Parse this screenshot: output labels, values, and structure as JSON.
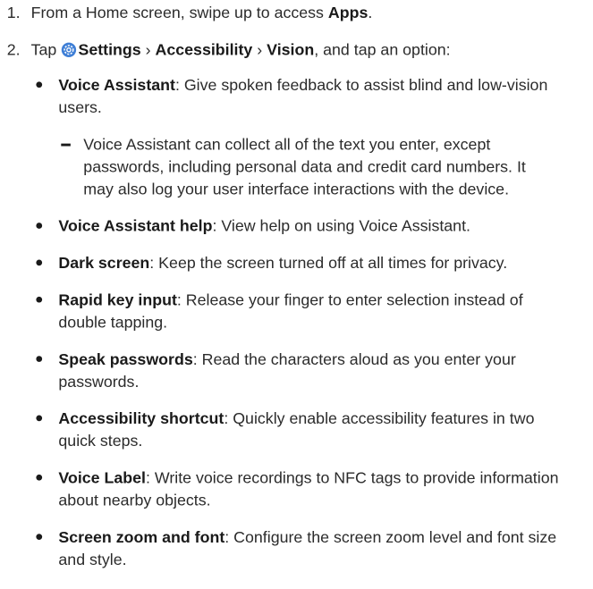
{
  "steps": [
    {
      "number": "1.",
      "text_before": "From a Home screen, swipe up to access ",
      "bold": "Apps",
      "text_after": "."
    },
    {
      "number": "2.",
      "tap": "Tap ",
      "settings": "Settings",
      "sep1": " › ",
      "accessibility": "Accessibility",
      "sep2": " › ",
      "vision": "Vision",
      "after": ", and tap an option:"
    }
  ],
  "bullets": [
    {
      "term": "Voice Assistant",
      "desc": ": Give spoken feedback to assist blind and low-vision users."
    },
    {
      "term": "Voice Assistant help",
      "desc": ": View help on using Voice Assistant."
    },
    {
      "term": "Dark screen",
      "desc": ": Keep the screen turned off at all times for privacy."
    },
    {
      "term": "Rapid key input",
      "desc": ": Release your finger to enter selection instead of double tapping."
    },
    {
      "term": "Speak passwords",
      "desc": ": Read the characters aloud as you enter your passwords."
    },
    {
      "term": "Accessibility shortcut",
      "desc": ": Quickly enable accessibility features in two quick steps."
    },
    {
      "term": "Voice Label",
      "desc": ": Write voice recordings to NFC tags to provide information about nearby objects."
    },
    {
      "term": "Screen zoom and font",
      "desc": ": Configure the screen zoom level and font size and style."
    }
  ],
  "sub_note": "Voice Assistant can collect all of the text you enter, except passwords, including personal data and credit card numbers. It may also log your user interface interactions with the device.",
  "icons": {
    "settings_icon": "gear-icon",
    "settings_icon_color": "#3f7fd6"
  }
}
